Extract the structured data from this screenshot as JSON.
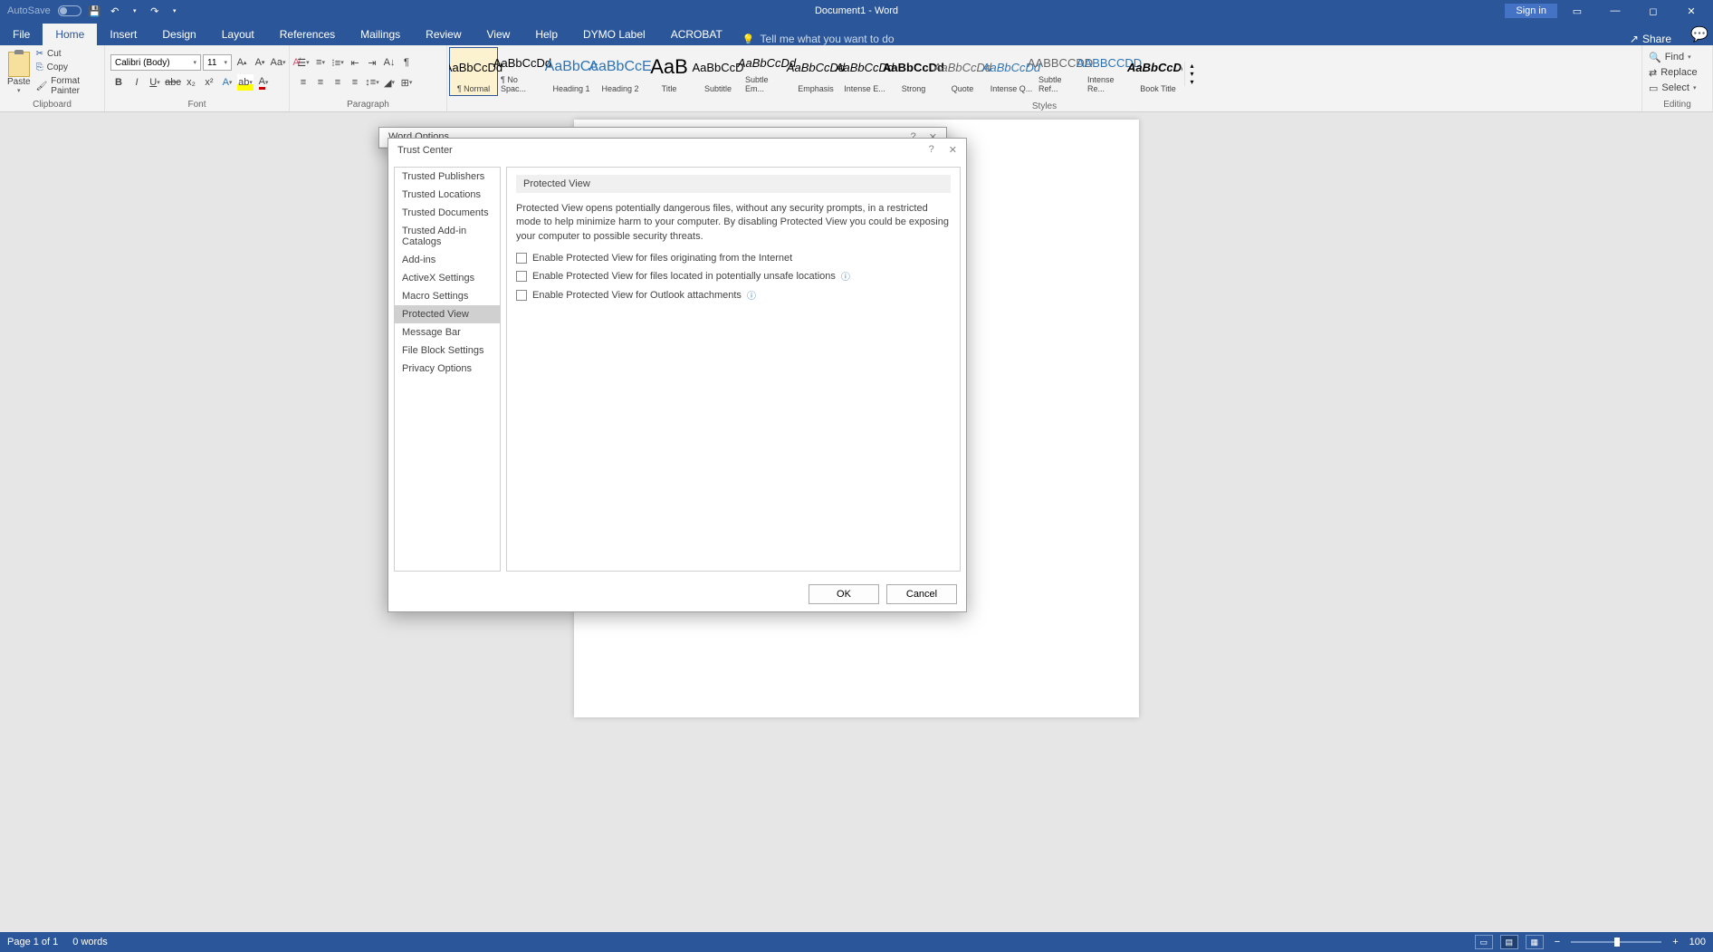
{
  "titlebar": {
    "autosave": "AutoSave",
    "title": "Document1 - Word",
    "signin": "Sign in"
  },
  "tabs": {
    "file": "File",
    "home": "Home",
    "insert": "Insert",
    "design": "Design",
    "layout": "Layout",
    "references": "References",
    "mailings": "Mailings",
    "review": "Review",
    "view": "View",
    "help": "Help",
    "dymo": "DYMO Label",
    "acrobat": "ACROBAT",
    "tellme": "Tell me what you want to do",
    "share": "Share"
  },
  "ribbon": {
    "clipboard": {
      "label": "Clipboard",
      "paste": "Paste",
      "cut": "Cut",
      "copy": "Copy",
      "fmtpainter": "Format Painter"
    },
    "font": {
      "label": "Font",
      "name": "Calibri (Body)",
      "size": "11"
    },
    "paragraph": {
      "label": "Paragraph"
    },
    "styles": {
      "label": "Styles",
      "items": [
        {
          "preview": "AaBbCcDd",
          "name": "¶ Normal",
          "cls": ""
        },
        {
          "preview": "AaBbCcDd",
          "name": "¶ No Spac...",
          "cls": ""
        },
        {
          "preview": "AaBbCc",
          "name": "Heading 1",
          "cls": "heading"
        },
        {
          "preview": "AaBbCcE",
          "name": "Heading 2",
          "cls": "heading"
        },
        {
          "preview": "AaB",
          "name": "Title",
          "cls": "title"
        },
        {
          "preview": "AaBbCcD",
          "name": "Subtitle",
          "cls": ""
        },
        {
          "preview": "AaBbCcDd",
          "name": "Subtle Em...",
          "cls": "emphasis"
        },
        {
          "preview": "AaBbCcDd",
          "name": "Emphasis",
          "cls": "emphasis"
        },
        {
          "preview": "AaBbCcDd",
          "name": "Intense E...",
          "cls": "emphasis"
        },
        {
          "preview": "AaBbCcDd",
          "name": "Strong",
          "cls": "strong"
        },
        {
          "preview": "AaBbCcDd",
          "name": "Quote",
          "cls": "quote"
        },
        {
          "preview": "AaBbCcDd",
          "name": "Intense Q...",
          "cls": "intenseq"
        },
        {
          "preview": "AABBCCDD",
          "name": "Subtle Ref...",
          "cls": "subtleref"
        },
        {
          "preview": "AABBCCDD",
          "name": "Intense Re...",
          "cls": "intenseref"
        },
        {
          "preview": "AaBbCcDd",
          "name": "Book Title",
          "cls": "booktitle"
        }
      ]
    },
    "editing": {
      "label": "Editing",
      "find": "Find",
      "replace": "Replace",
      "select": "Select"
    }
  },
  "wordoptions": {
    "title": "Word Options"
  },
  "trustcenter": {
    "title": "Trust Center",
    "sidebar": [
      "Trusted Publishers",
      "Trusted Locations",
      "Trusted Documents",
      "Trusted Add-in Catalogs",
      "Add-ins",
      "ActiveX Settings",
      "Macro Settings",
      "Protected View",
      "Message Bar",
      "File Block Settings",
      "Privacy Options"
    ],
    "heading": "Protected View",
    "desc": "Protected View opens potentially dangerous files, without any security prompts, in a restricted mode to help minimize harm to your computer. By disabling Protected View you could be exposing your computer to possible security threats.",
    "check1": "Enable Protected View for files originating from the Internet",
    "check2": "Enable Protected View for files located in potentially unsafe locations",
    "check3": "Enable Protected View for Outlook attachments",
    "ok": "OK",
    "cancel": "Cancel"
  },
  "statusbar": {
    "page": "Page 1 of 1",
    "words": "0 words",
    "zoom": "100"
  }
}
